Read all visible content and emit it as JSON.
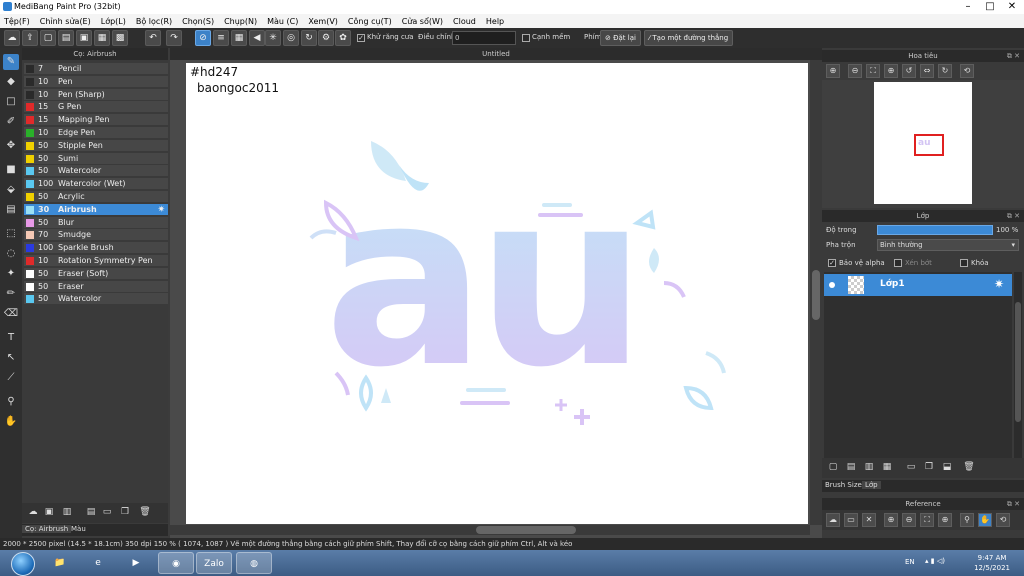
{
  "window": {
    "title": "MediBang Paint Pro (32bit)",
    "controls": [
      "–",
      "□",
      "✕"
    ]
  },
  "menu": [
    "Tệp(F)",
    "Chỉnh sửa(E)",
    "Lớp(L)",
    "Bộ lọc(R)",
    "Chọn(S)",
    "Chụp(N)",
    "Màu (C)",
    "Xem(V)",
    "Công cụ(T)",
    "Cửa sổ(W)",
    "Cloud",
    "Help"
  ],
  "toolbar": {
    "antialias_label": "Khử răng cưa",
    "adjust_label": "Điều chỉnh",
    "adjust_value": "0",
    "edge_label": "Cạnh mềm",
    "key_label": "Phím",
    "reset_label": "Đặt lại",
    "straight_line_label": "Tạo một đường thẳng"
  },
  "brush_panel": {
    "title": "Cọ: Airbrush",
    "brushes": [
      {
        "size": "7",
        "name": "Pencil",
        "color": "#2a2a2a",
        "selected": false
      },
      {
        "size": "10",
        "name": "Pen",
        "color": "#2a2a2a",
        "selected": false
      },
      {
        "size": "10",
        "name": "Pen (Sharp)",
        "color": "#2a2a2a",
        "selected": false
      },
      {
        "size": "15",
        "name": "G Pen",
        "color": "#e02a2a",
        "selected": false
      },
      {
        "size": "15",
        "name": "Mapping Pen",
        "color": "#e02a2a",
        "selected": false
      },
      {
        "size": "10",
        "name": "Edge Pen",
        "color": "#2ab02a",
        "selected": false
      },
      {
        "size": "50",
        "name": "Stipple Pen",
        "color": "#f0d000",
        "selected": false
      },
      {
        "size": "50",
        "name": "Sumi",
        "color": "#f0d000",
        "selected": false
      },
      {
        "size": "50",
        "name": "Watercolor",
        "color": "#5ac8f0",
        "selected": false
      },
      {
        "size": "100",
        "name": "Watercolor (Wet)",
        "color": "#5ac8f0",
        "selected": false
      },
      {
        "size": "50",
        "name": "Acrylic",
        "color": "#f0d000",
        "selected": false
      },
      {
        "size": "30",
        "name": "Airbrush",
        "color": "#9be0f5",
        "selected": true
      },
      {
        "size": "50",
        "name": "Blur",
        "color": "#e89ae8",
        "selected": false
      },
      {
        "size": "70",
        "name": "Smudge",
        "color": "#f5c8b4",
        "selected": false
      },
      {
        "size": "100",
        "name": "Sparkle Brush",
        "color": "#2a3ae0",
        "selected": false
      },
      {
        "size": "10",
        "name": "Rotation Symmetry Pen",
        "color": "#e02a2a",
        "selected": false
      },
      {
        "size": "50",
        "name": "Eraser (Soft)",
        "color": "#ffffff",
        "selected": false
      },
      {
        "size": "50",
        "name": "Eraser",
        "color": "#ffffff",
        "selected": false
      },
      {
        "size": "50",
        "name": "Watercolor",
        "color": "#5ac8f0",
        "selected": false
      }
    ],
    "tabs": [
      "Cọ: Airbrush",
      "Màu"
    ]
  },
  "canvas": {
    "tab_title": "Untitled",
    "text_line1": "#hd247",
    "text_line2": "baongoc2011",
    "art_text": "au",
    "gradient_top": "#bfe7f7",
    "gradient_bottom": "#d9c4f6"
  },
  "navigator": {
    "title": "Hoa tiêu",
    "thumb_text": "au"
  },
  "layer_panel": {
    "title": "Lớp",
    "opacity_label": "Độ trong",
    "opacity_value": "100 %",
    "opacity_fraction": 1.0,
    "blend_label": "Pha trộn",
    "blend_value": "Bình thường",
    "protect_alpha_label": "Bảo vệ alpha",
    "clip_label": "Xén bớt",
    "lock_label": "Khóa",
    "layer_name": "Lớp1",
    "tabs": [
      "Brush Size",
      "Lớp"
    ]
  },
  "reference": {
    "title": "Reference"
  },
  "status": {
    "text": "2000 * 2500 pixel   (14.5 * 18.1cm)   350 dpi   150 %   ( 1074, 1087 )   Vẽ một đường thẳng bằng cách giữ phím Shift, Thay đổi cỡ cọ bằng cách giữ phím Ctrl, Alt và kéo"
  },
  "taskbar": {
    "apps": [
      "explorer-icon",
      "internet-explorer-icon",
      "media-player-icon",
      "green-app-icon",
      "zalo-icon",
      "chrome-icon"
    ],
    "zalo_label": "Zalo",
    "lang": "EN",
    "time": "9:47 AM",
    "date": "12/5/2021"
  },
  "colors": {
    "accent": "#3c8ad6",
    "panel": "#3a3a3a",
    "header": "#2a2a2a"
  }
}
